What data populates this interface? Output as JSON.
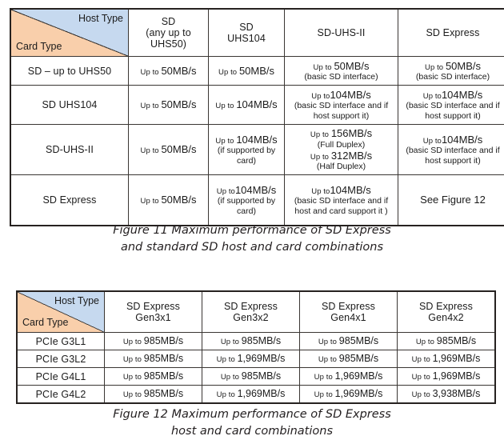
{
  "figure11": {
    "corner": {
      "host_label": "Host Type",
      "card_label": "Card Type"
    },
    "columns": [
      "SD\n(any up to\nUHS50)",
      "SD\nUHS104",
      "SD-UHS-II",
      "SD Express"
    ],
    "columns_flat": [
      "SD (any up to UHS50)",
      "SD UHS104",
      "SD-UHS-II",
      "SD Express"
    ],
    "rows": [
      {
        "label": "SD – up to UHS50",
        "cells": [
          {
            "prefix": "Up to ",
            "value": "50MB/s",
            "note": ""
          },
          {
            "prefix": "Up to ",
            "value": "50MB/s",
            "note": ""
          },
          {
            "prefix": "Up to ",
            "value": "50MB/s",
            "note": "(basic SD interface)"
          },
          {
            "prefix": "Up to ",
            "value": "50MB/s",
            "note": "(basic SD interface)"
          }
        ]
      },
      {
        "label": "SD UHS104",
        "cells": [
          {
            "prefix": "Up to ",
            "value": "50MB/s",
            "note": ""
          },
          {
            "prefix": "Up to ",
            "value": "104MB/s",
            "note": ""
          },
          {
            "prefix": "Up to",
            "value": "104MB/s",
            "note": "(basic SD interface and if host support it)"
          },
          {
            "prefix": "Up to",
            "value": "104MB/s",
            "note": "(basic SD interface and if host support it)"
          }
        ]
      },
      {
        "label": "SD-UHS-II",
        "cells": [
          {
            "prefix": "Up to ",
            "value": "50MB/s",
            "note": ""
          },
          {
            "prefix": "Up to ",
            "value": "104MB/s",
            "note": "(if supported by card)"
          },
          {
            "prefix": "Up to ",
            "value": "156MB/s",
            "note": "(Full Duplex)",
            "prefix2": "Up to ",
            "value2": "312MB/s",
            "note2": "(Half Duplex)"
          },
          {
            "prefix": "Up to",
            "value": "104MB/s",
            "note": "(basic SD interface and if host support it)"
          }
        ]
      },
      {
        "label": "SD Express",
        "cells": [
          {
            "prefix": "Up to ",
            "value": "50MB/s",
            "note": ""
          },
          {
            "prefix": "Up to",
            "value": "104MB/s",
            "note": "(if supported by card)"
          },
          {
            "prefix": "Up to",
            "value": "104MB/s",
            "note": "(basic SD interface and if host and card support it )"
          },
          {
            "plain": "See Figure 12"
          }
        ]
      }
    ],
    "caption_line1": "Figure 11 Maximum performance of SD Express",
    "caption_line2": "and standard SD host and card combinations"
  },
  "figure12": {
    "corner": {
      "host_label": "Host Type",
      "card_label": "Card Type"
    },
    "columns": [
      "SD Express\nGen3x1",
      "SD Express\nGen3x2",
      "SD Express\nGen4x1",
      "SD Express\nGen4x2"
    ],
    "columns_flat": [
      "SD Express Gen3x1",
      "SD Express Gen3x2",
      "SD Express Gen4x1",
      "SD Express Gen4x2"
    ],
    "rows": [
      {
        "label": "PCIe G3L1",
        "cells": [
          {
            "prefix": "Up to ",
            "value": "985MB/s"
          },
          {
            "prefix": "Up to ",
            "value": "985MB/s"
          },
          {
            "prefix": "Up to ",
            "value": "985MB/s"
          },
          {
            "prefix": "Up to ",
            "value": "985MB/s"
          }
        ]
      },
      {
        "label": "PCIe G3L2",
        "cells": [
          {
            "prefix": "Up to ",
            "value": "985MB/s"
          },
          {
            "prefix": "Up to ",
            "value": "1,969MB/s"
          },
          {
            "prefix": "Up to ",
            "value": "985MB/s"
          },
          {
            "prefix": "Up to ",
            "value": "1,969MB/s"
          }
        ]
      },
      {
        "label": "PCIe G4L1",
        "cells": [
          {
            "prefix": "Up to ",
            "value": "985MB/s"
          },
          {
            "prefix": "Up to ",
            "value": "985MB/s"
          },
          {
            "prefix": "Up to ",
            "value": "1,969MB/s"
          },
          {
            "prefix": "Up to ",
            "value": "1,969MB/s"
          }
        ]
      },
      {
        "label": "PCIe G4L2",
        "cells": [
          {
            "prefix": "Up to ",
            "value": "985MB/s"
          },
          {
            "prefix": "Up to ",
            "value": "1,969MB/s"
          },
          {
            "prefix": "Up to ",
            "value": "1,969MB/s"
          },
          {
            "prefix": "Up to ",
            "value": "3,938MB/s"
          }
        ]
      }
    ],
    "caption_line1": "Figure 12 Maximum performance of SD Express",
    "caption_line2": "host and card combinations"
  },
  "colors": {
    "header_blue": "#c6d9ef",
    "row_header_orange": "#f9cfab",
    "border_dark": "#262220",
    "grid_line": "#3a3633",
    "text": "#1b1b1b",
    "caption_text": "#231f20"
  }
}
